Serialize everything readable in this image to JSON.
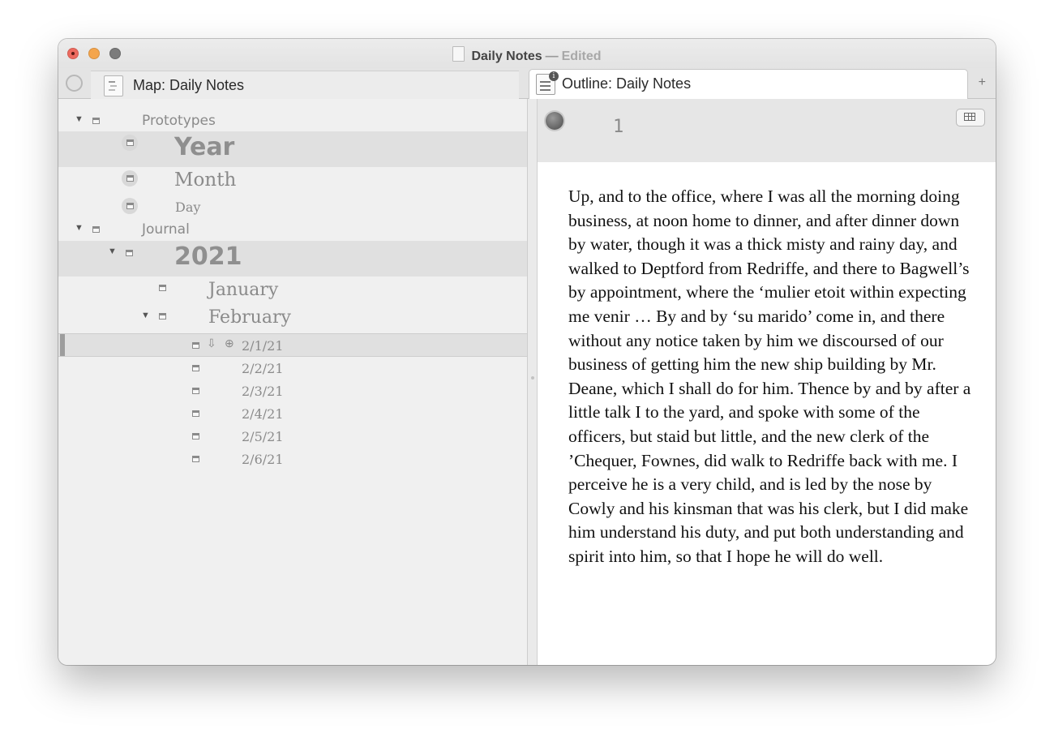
{
  "window": {
    "title": "Daily Notes",
    "title_separator": "—",
    "title_status": "Edited"
  },
  "tabs": {
    "map_label": "Map: Daily Notes",
    "outline_label": "Outline: Daily Notes",
    "add_label": "+"
  },
  "outline": {
    "prototypes": "Prototypes",
    "year": "Year",
    "month": "Month",
    "day": "Day",
    "journal": "Journal",
    "y2021": "2021",
    "january": "January",
    "february": "February",
    "dates": [
      "2/1/21",
      "2/2/21",
      "2/3/21",
      "2/4/21",
      "2/5/21",
      "2/6/21"
    ]
  },
  "note": {
    "title": "1",
    "text": "Up, and to the office, where I was all the morning doing business, at noon home to dinner, and after dinner down by water, though it was a thick misty and rainy day, and walked to Deptford from Redriffe, and there to Bagwell’s by appointment, where the ‘mulier etoit within expecting me venir … By and by ‘su marido’ come in, and there without any notice taken by him we discoursed of our business of getting him the new ship building by Mr. Deane, which I shall do for him. Thence by and by after a little talk I to the yard, and spoke with some of the officers, but staid but little, and the new clerk of the ’Chequer, Fownes, did walk to Redriffe back with me. I perceive he is a very child, and is led by the nose by Cowly and his kinsman that was his clerk, but I did make him understand his duty, and put both understanding and spirit into him, so that I hope he will do well."
  },
  "icons": {
    "close": "close-icon",
    "minimize": "minimize-icon",
    "maximize": "maximize-icon",
    "disclosure": "disclosure-triangle-icon",
    "note": "note-icon",
    "table": "table-icon",
    "outline_item": "outline-item-icon"
  },
  "colors": {
    "close": "#ed6a5f",
    "minimize": "#f4a54c",
    "maximize": "#7c7c7c",
    "outline_text": "#8a8a8a",
    "selected_row": "#e0e0e0"
  }
}
